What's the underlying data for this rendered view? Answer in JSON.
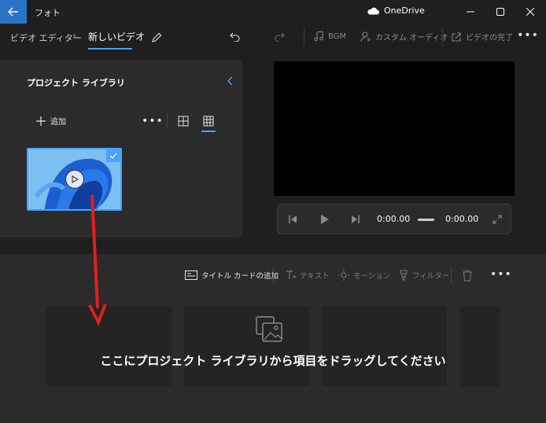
{
  "app": {
    "title": "フォト"
  },
  "onedrive": {
    "label": "OneDrive"
  },
  "breadcrumb": {
    "root": "ビデオ エディター",
    "current": "新しいビデオ"
  },
  "toolbar": {
    "bgm": "BGM",
    "custom_audio": "カスタム オーディオ",
    "finish": "ビデオの完了"
  },
  "library": {
    "title": "プロジェクト ライブラリ",
    "add_label": "追加"
  },
  "player": {
    "current_time": "0:00.00",
    "duration": "0:00.00"
  },
  "storyboard": {
    "add_title_card": "タイトル カードの追加",
    "text": "テキスト",
    "motion": "モーション",
    "filter": "フィルター",
    "drop_message": "ここにプロジェクト ライブラリから項目をドラッグしてください"
  },
  "colors": {
    "accent": "#4aa3ff",
    "back_button": "#2a73c9",
    "annotation_arrow": "#e0201c"
  }
}
